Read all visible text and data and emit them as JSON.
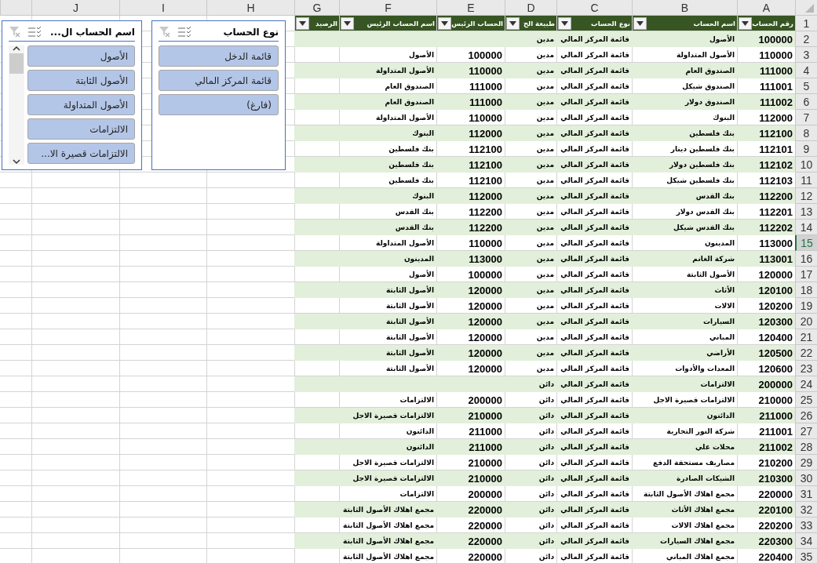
{
  "column_letters": [
    "A",
    "B",
    "C",
    "D",
    "E",
    "F",
    "G",
    "H",
    "I",
    "J"
  ],
  "table": {
    "header_row": "1",
    "headers": [
      "رقم الحساب",
      "اسم الحساب",
      "نوع الحساب",
      "طبيعة الح",
      "الحساب الرئيس",
      "اسم الحساب الرئيس",
      "الرصيد"
    ],
    "rows": [
      {
        "number": "2",
        "selected": false,
        "account_no": "100000",
        "account_name": "الأصول",
        "statement": "قائمة المركز المالي",
        "nature": "مدين"
      },
      {
        "number": "3",
        "selected": false,
        "account_no": "110000",
        "account_name": "الأصول المتداولة",
        "statement": "قائمة المركز المالي",
        "nature": "مدين",
        "parent_no": "100000",
        "parent_name": "الأصول"
      },
      {
        "number": "4",
        "selected": false,
        "account_no": "111000",
        "account_name": "الصندوق العام",
        "statement": "قائمة المركز المالي",
        "nature": "مدين",
        "parent_no": "110000",
        "parent_name": "الأصول المتداولة"
      },
      {
        "number": "5",
        "selected": false,
        "account_no": "111001",
        "account_name": "الصندوق شيكل",
        "statement": "قائمة المركز المالي",
        "nature": "مدين",
        "parent_no": "111000",
        "parent_name": "الصندوق العام"
      },
      {
        "number": "6",
        "selected": false,
        "account_no": "111002",
        "account_name": "الصندوق دولار",
        "statement": "قائمة المركز المالي",
        "nature": "مدين",
        "parent_no": "111000",
        "parent_name": "الصندوق العام"
      },
      {
        "number": "7",
        "selected": false,
        "account_no": "112000",
        "account_name": "البنوك",
        "statement": "قائمة المركز المالي",
        "nature": "مدين",
        "parent_no": "110000",
        "parent_name": "الأصول المتداولة"
      },
      {
        "number": "8",
        "selected": false,
        "account_no": "112100",
        "account_name": "بنك فلسطين",
        "statement": "قائمة المركز المالي",
        "nature": "مدين",
        "parent_no": "112000",
        "parent_name": "البنوك"
      },
      {
        "number": "9",
        "selected": false,
        "account_no": "112101",
        "account_name": "بنك فلسطين دينار",
        "statement": "قائمة المركز المالي",
        "nature": "مدين",
        "parent_no": "112100",
        "parent_name": "بنك فلسطين"
      },
      {
        "number": "10",
        "selected": false,
        "account_no": "112102",
        "account_name": "بنك فلسطين دولار",
        "statement": "قائمة المركز المالي",
        "nature": "مدين",
        "parent_no": "112100",
        "parent_name": "بنك فلسطين"
      },
      {
        "number": "11",
        "selected": false,
        "account_no": "112103",
        "account_name": "بنك فلسطين شيكل",
        "statement": "قائمة المركز المالي",
        "nature": "مدين",
        "parent_no": "112100",
        "parent_name": "بنك فلسطين"
      },
      {
        "number": "12",
        "selected": false,
        "account_no": "112200",
        "account_name": "بنك القدس",
        "statement": "قائمة المركز المالي",
        "nature": "مدين",
        "parent_no": "112000",
        "parent_name": "البنوك"
      },
      {
        "number": "13",
        "selected": false,
        "account_no": "112201",
        "account_name": "بنك القدس دولار",
        "statement": "قائمة المركز المالي",
        "nature": "مدين",
        "parent_no": "112200",
        "parent_name": "بنك القدس"
      },
      {
        "number": "14",
        "selected": false,
        "account_no": "112202",
        "account_name": "بنك القدس شيكل",
        "statement": "قائمة المركز المالي",
        "nature": "مدين",
        "parent_no": "112200",
        "parent_name": "بنك القدس"
      },
      {
        "number": "15",
        "selected": true,
        "account_no": "113000",
        "account_name": "المدينون",
        "statement": "قائمة المركز المالي",
        "nature": "مدين",
        "parent_no": "110000",
        "parent_name": "الأصول المتداولة"
      },
      {
        "number": "16",
        "selected": false,
        "account_no": "113001",
        "account_name": "شركة الغانم",
        "statement": "قائمة المركز المالي",
        "nature": "مدين",
        "parent_no": "113000",
        "parent_name": "المدينون"
      },
      {
        "number": "17",
        "selected": false,
        "account_no": "120000",
        "account_name": "الأصول الثابتة",
        "statement": "قائمة المركز المالي",
        "nature": "مدين",
        "parent_no": "100000",
        "parent_name": "الأصول"
      },
      {
        "number": "18",
        "selected": false,
        "account_no": "120100",
        "account_name": "الأثاث",
        "statement": "قائمة المركز المالي",
        "nature": "مدين",
        "parent_no": "120000",
        "parent_name": "الأصول الثابتة"
      },
      {
        "number": "19",
        "selected": false,
        "account_no": "120200",
        "account_name": "الالات",
        "statement": "قائمة المركز المالي",
        "nature": "مدين",
        "parent_no": "120000",
        "parent_name": "الأصول الثابتة"
      },
      {
        "number": "20",
        "selected": false,
        "account_no": "120300",
        "account_name": "السيارات",
        "statement": "قائمة المركز المالي",
        "nature": "مدين",
        "parent_no": "120000",
        "parent_name": "الأصول الثابتة"
      },
      {
        "number": "21",
        "selected": false,
        "account_no": "120400",
        "account_name": "المباني",
        "statement": "قائمة المركز المالي",
        "nature": "مدين",
        "parent_no": "120000",
        "parent_name": "الأصول الثابتة"
      },
      {
        "number": "22",
        "selected": false,
        "account_no": "120500",
        "account_name": "الأراضي",
        "statement": "قائمة المركز المالي",
        "nature": "مدين",
        "parent_no": "120000",
        "parent_name": "الأصول الثابتة"
      },
      {
        "number": "23",
        "selected": false,
        "account_no": "120600",
        "account_name": "المعدات والأدوات",
        "statement": "قائمة المركز المالي",
        "nature": "مدين",
        "parent_no": "120000",
        "parent_name": "الأصول الثابتة"
      },
      {
        "number": "24",
        "selected": false,
        "account_no": "200000",
        "account_name": "الالتزامات",
        "statement": "قائمة المركز المالي",
        "nature": "دائن"
      },
      {
        "number": "25",
        "selected": false,
        "account_no": "210000",
        "account_name": "الالتزامات قصيرة الاجل",
        "statement": "قائمة المركز المالي",
        "nature": "دائن",
        "parent_no": "200000",
        "parent_name": "الالتزامات"
      },
      {
        "number": "26",
        "selected": false,
        "account_no": "211000",
        "account_name": "الدائنون",
        "statement": "قائمة المركز المالي",
        "nature": "دائن",
        "parent_no": "210000",
        "parent_name": "الالتزامات قصيرة الاجل"
      },
      {
        "number": "27",
        "selected": false,
        "account_no": "211001",
        "account_name": "شركة النور التجارية",
        "statement": "قائمة المركز المالي",
        "nature": "دائن",
        "parent_no": "211000",
        "parent_name": "الدائنون"
      },
      {
        "number": "28",
        "selected": false,
        "account_no": "211002",
        "account_name": "محلات علي",
        "statement": "قائمة المركز المالي",
        "nature": "دائن",
        "parent_no": "211000",
        "parent_name": "الدائنون"
      },
      {
        "number": "29",
        "selected": false,
        "account_no": "210200",
        "account_name": "مصاريف مستحقة الدفع",
        "statement": "قائمة المركز المالي",
        "nature": "دائن",
        "parent_no": "210000",
        "parent_name": "الالتزامات قصيرة الاجل"
      },
      {
        "number": "30",
        "selected": false,
        "account_no": "210300",
        "account_name": "الشيكات الصادرة",
        "statement": "قائمة المركز المالي",
        "nature": "دائن",
        "parent_no": "210000",
        "parent_name": "الالتزامات قصيرة الاجل"
      },
      {
        "number": "31",
        "selected": false,
        "account_no": "220000",
        "account_name": "مجمع اهلاك الأصول الثابتة",
        "statement": "قائمة المركز المالي",
        "nature": "دائن",
        "parent_no": "200000",
        "parent_name": "الالتزامات"
      },
      {
        "number": "32",
        "selected": false,
        "account_no": "220100",
        "account_name": "مجمع اهلاك الأثاث",
        "statement": "قائمة المركز المالي",
        "nature": "دائن",
        "parent_no": "220000",
        "parent_name": "مجمع اهلاك الأصول الثابتة"
      },
      {
        "number": "33",
        "selected": false,
        "account_no": "220200",
        "account_name": "مجمع اهلاك الالات",
        "statement": "قائمة المركز المالي",
        "nature": "دائن",
        "parent_no": "220000",
        "parent_name": "مجمع اهلاك الأصول الثابتة"
      },
      {
        "number": "34",
        "selected": false,
        "account_no": "220300",
        "account_name": "مجمع اهلاك السيارات",
        "statement": "قائمة المركز المالي",
        "nature": "دائن",
        "parent_no": "220000",
        "parent_name": "مجمع اهلاك الأصول الثابتة"
      },
      {
        "number": "35",
        "selected": false,
        "account_no": "220400",
        "account_name": "مجمع اهلاك المباني",
        "statement": "قائمة المركز المالي",
        "nature": "دائن",
        "parent_no": "220000",
        "parent_name": "مجمع اهلاك الأصول الثابتة"
      }
    ]
  },
  "slicers": [
    {
      "title": "نوع الحساب",
      "items": [
        {
          "label": "قائمة الدخل",
          "selected": true
        },
        {
          "label": "قائمة المركز المالي",
          "selected": true
        },
        {
          "label": "(فارغ)",
          "selected": true
        }
      ]
    },
    {
      "title": "اسم الحساب ال...",
      "items": [
        {
          "label": "الأصول",
          "selected": true
        },
        {
          "label": "الأصول الثابتة",
          "selected": true
        },
        {
          "label": "الأصول المتداولة",
          "selected": true
        },
        {
          "label": "الالتزامات",
          "selected": true
        },
        {
          "label": "الالتزامات قصيرة الا...",
          "selected": true
        }
      ]
    }
  ]
}
